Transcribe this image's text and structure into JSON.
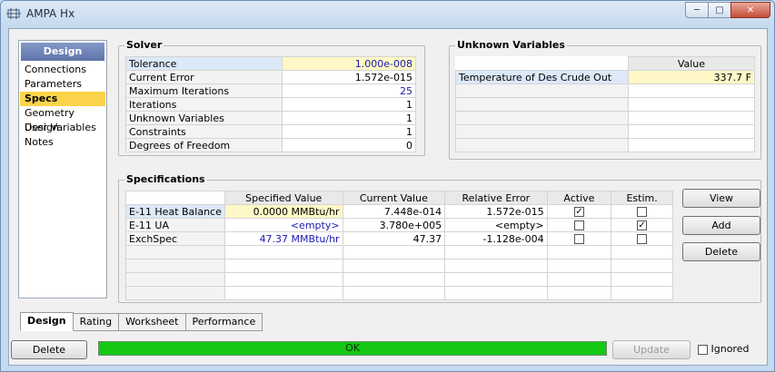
{
  "window": {
    "title": "AMPA Hx"
  },
  "nav": {
    "header": "Design",
    "items": [
      {
        "label": "Connections",
        "selected": false
      },
      {
        "label": "Parameters",
        "selected": false
      },
      {
        "label": "Specs",
        "selected": true
      },
      {
        "label": "Geometry Design",
        "selected": false
      },
      {
        "label": "User Variables",
        "selected": false
      },
      {
        "label": "Notes",
        "selected": false
      }
    ]
  },
  "solver": {
    "title": "Solver",
    "rows": [
      {
        "label": "Tolerance",
        "value": "1.000e-008"
      },
      {
        "label": "Current Error",
        "value": "1.572e-015"
      },
      {
        "label": "Maximum Iterations",
        "value": "25"
      },
      {
        "label": "Iterations",
        "value": "1"
      },
      {
        "label": "Unknown Variables",
        "value": "1"
      },
      {
        "label": "Constraints",
        "value": "1"
      },
      {
        "label": "Degrees of Freedom",
        "value": "0"
      }
    ]
  },
  "unknown": {
    "title": "Unknown Variables",
    "header": "Value",
    "rows": [
      {
        "label": "Temperature of Des Crude Out",
        "value": "337.7 F"
      }
    ]
  },
  "specs": {
    "title": "Specifications",
    "columns": [
      "Specified Value",
      "Current Value",
      "Relative Error",
      "Active",
      "Estim."
    ],
    "rows": [
      {
        "name": "E-11 Heat Balance",
        "specified": "0.0000 MMBtu/hr",
        "current": "7.448e-014",
        "error": "1.572e-015",
        "active": true,
        "estim": false
      },
      {
        "name": "E-11 UA",
        "specified": "<empty>",
        "current": "3.780e+005",
        "error": "<empty>",
        "active": false,
        "estim": true
      },
      {
        "name": "ExchSpec",
        "specified": "47.37 MMBtu/hr",
        "current": "47.37",
        "error": "-1.128e-004",
        "active": false,
        "estim": false
      }
    ],
    "buttons": {
      "view": "View",
      "add": "Add",
      "delete": "Delete"
    }
  },
  "tabs": [
    "Design",
    "Rating",
    "Worksheet",
    "Performance"
  ],
  "footer": {
    "delete": "Delete",
    "status": "OK",
    "update": "Update",
    "ignored": "Ignored",
    "status_color": "#14c814"
  }
}
